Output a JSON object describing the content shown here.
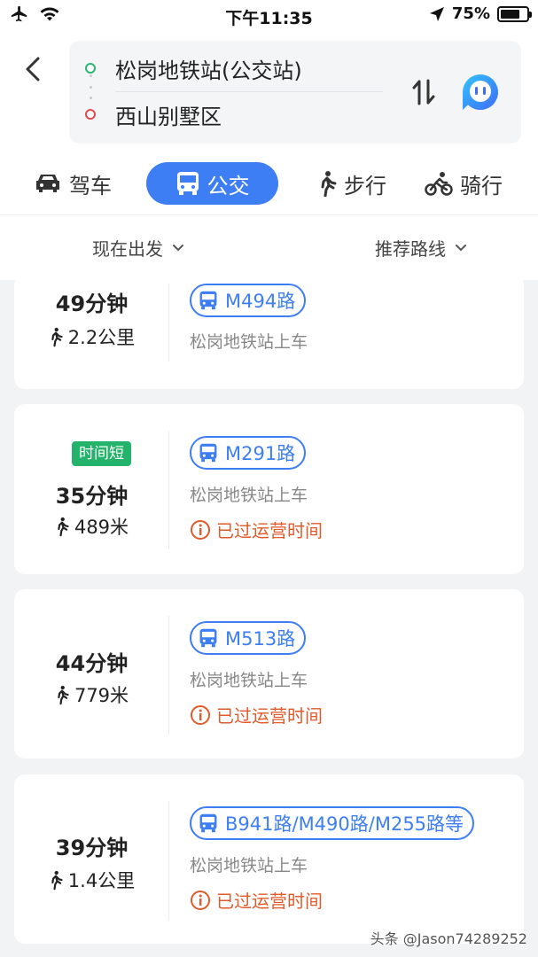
{
  "status_bar": {
    "time": "下午11:35",
    "battery": "75%",
    "battery_level": 0.75
  },
  "route": {
    "from": "松岗地铁站(公交站)",
    "to": "西山别墅区"
  },
  "modes": [
    {
      "label": "驾车",
      "icon": "car-icon"
    },
    {
      "label": "公交",
      "icon": "bus-icon",
      "active": true
    },
    {
      "label": "步行",
      "icon": "walk-icon"
    },
    {
      "label": "骑行",
      "icon": "bike-icon"
    }
  ],
  "filters": {
    "depart": "现在出发",
    "sort": "推荐路线"
  },
  "routes": [
    {
      "duration": "49分钟",
      "walk": "2.2公里",
      "line": "M494路",
      "board": "松岗地铁站上车"
    },
    {
      "badge": "时间短",
      "duration": "35分钟",
      "walk": "489米",
      "line": "M291路",
      "board": "松岗地铁站上车",
      "warning": "已过运营时间"
    },
    {
      "duration": "44分钟",
      "walk": "779米",
      "line": "M513路",
      "board": "松岗地铁站上车",
      "warning": "已过运营时间"
    },
    {
      "duration": "39分钟",
      "walk": "1.4公里",
      "line": "B941路/M490路/M255路等",
      "board": "松岗地铁站上车",
      "warning": "已过运营时间"
    }
  ],
  "watermark": "头条 @Jason74289252",
  "colors": {
    "accent": "#3d7ef5",
    "badge_green": "#23b36a",
    "warning": "#e05a2b",
    "origin_dot": "#2bb673",
    "destination_dot": "#e5484d"
  }
}
